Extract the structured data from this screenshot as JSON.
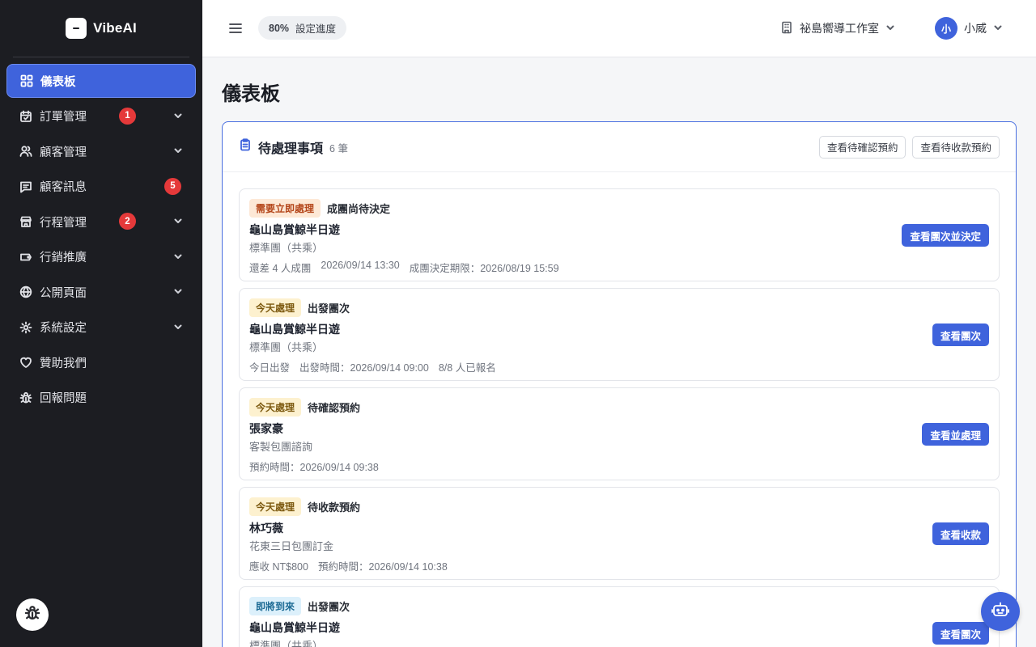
{
  "brand": {
    "name": "VibeAI"
  },
  "sidebar": {
    "items": [
      {
        "label": "儀表板",
        "icon": "dashboard-icon",
        "active": true
      },
      {
        "label": "訂單管理",
        "icon": "calendar-check-icon",
        "badge": "1",
        "has_chevron": true
      },
      {
        "label": "顧客管理",
        "icon": "users-icon",
        "has_chevron": true
      },
      {
        "label": "顧客訊息",
        "icon": "message-icon",
        "badge": "5"
      },
      {
        "label": "行程管理",
        "icon": "store-icon",
        "badge": "2",
        "has_chevron": true
      },
      {
        "label": "行銷推廣",
        "icon": "tag-icon",
        "has_chevron": true
      },
      {
        "label": "公開頁面",
        "icon": "globe-icon",
        "has_chevron": true
      },
      {
        "label": "系統設定",
        "icon": "gear-icon",
        "has_chevron": true
      },
      {
        "label": "贊助我們",
        "icon": "heart-icon"
      },
      {
        "label": "回報問題",
        "icon": "bug-icon"
      }
    ]
  },
  "header": {
    "progress": {
      "percent": "80%",
      "label": "設定進度"
    },
    "studio": "祕島嚮導工作室",
    "user": {
      "initial": "小",
      "name": "小威"
    }
  },
  "main": {
    "title": "儀表板",
    "panel": {
      "title": "待處理事項",
      "count": "6 筆",
      "actions": [
        "查看待確認預約",
        "查看待收款預約"
      ],
      "tasks": [
        {
          "tag": "需要立即處理",
          "tag_style": "urgent",
          "type": "成團尚待決定",
          "name": "龜山島賞鯨半日遊",
          "sub": "標準團（共乘）",
          "meta": [
            "還差 4 人成團",
            "2026/09/14 13:30",
            "成團決定期限：2026/08/19 15:59"
          ],
          "button": "查看團次並決定"
        },
        {
          "tag": "今天處理",
          "tag_style": "today",
          "type": "出發團次",
          "name": "龜山島賞鯨半日遊",
          "sub": "標準團（共乘）",
          "meta": [
            "今日出發",
            "出發時間：2026/09/14 09:00",
            "8/8 人已報名"
          ],
          "button": "查看團次"
        },
        {
          "tag": "今天處理",
          "tag_style": "today",
          "type": "待確認預約",
          "name": "張家豪",
          "sub": "客製包團諮詢",
          "meta": [
            "預約時間：2026/09/14 09:38"
          ],
          "button": "查看並處理"
        },
        {
          "tag": "今天處理",
          "tag_style": "today",
          "type": "待收款預約",
          "name": "林巧薇",
          "sub": "花東三日包團訂金",
          "meta": [
            "應收 NT$800",
            "預約時間：2026/09/14 10:38"
          ],
          "button": "查看收款"
        },
        {
          "tag": "即將到來",
          "tag_style": "soon",
          "type": "出發團次",
          "name": "龜山島賞鯨半日遊",
          "sub": "標準團（共乘）",
          "meta": [],
          "button": "查看團次"
        }
      ]
    }
  },
  "colors": {
    "accent": "#3f63dc",
    "sidebar_bg": "#1c1d22",
    "badge": "#e5393a"
  }
}
